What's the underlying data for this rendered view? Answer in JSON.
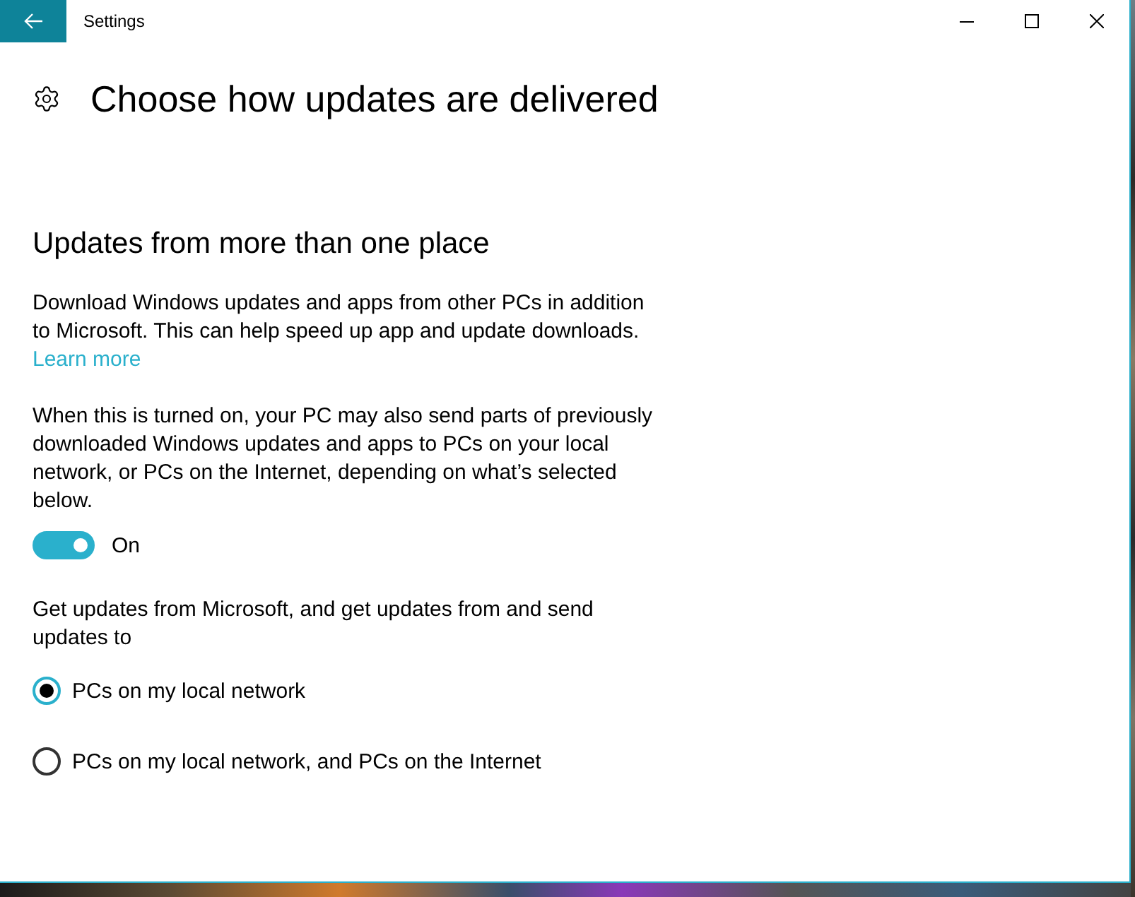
{
  "window": {
    "title": "Settings"
  },
  "page": {
    "title": "Choose how updates are delivered"
  },
  "section": {
    "heading": "Updates from more than one place",
    "description": "Download Windows updates and apps from other PCs in addition to Microsoft. This can help speed up app and update downloads.",
    "link": "Learn more",
    "note": "When this is turned on, your PC may also send parts of previously downloaded Windows updates and apps to PCs on your local network, or PCs on the Internet, depending on what’s selected below.",
    "toggle": {
      "on": true,
      "label": "On"
    },
    "prompt": "Get updates from Microsoft, and get updates from and send updates to",
    "options": [
      {
        "label": "PCs on my local network",
        "selected": true
      },
      {
        "label": "PCs on my local network, and PCs on the Internet",
        "selected": false
      }
    ]
  }
}
